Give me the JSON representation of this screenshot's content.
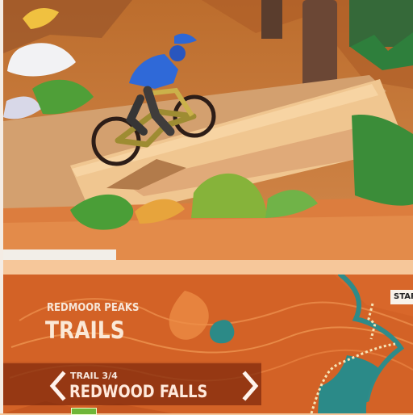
{
  "game": {
    "region_name": "REDMOOR PEAKS",
    "section_title": "TRAILS",
    "trail": {
      "counter": "TRAIL 3/4",
      "name": "REDWOOD FALLS"
    },
    "map_marker": "STAR",
    "icons": {
      "previous": "chevron-left-icon",
      "next": "chevron-right-icon"
    },
    "colors": {
      "terrain": "#c97a3c",
      "map": "#d9692a",
      "accent": "#2f8b89",
      "rider": "#2f69d8"
    }
  }
}
